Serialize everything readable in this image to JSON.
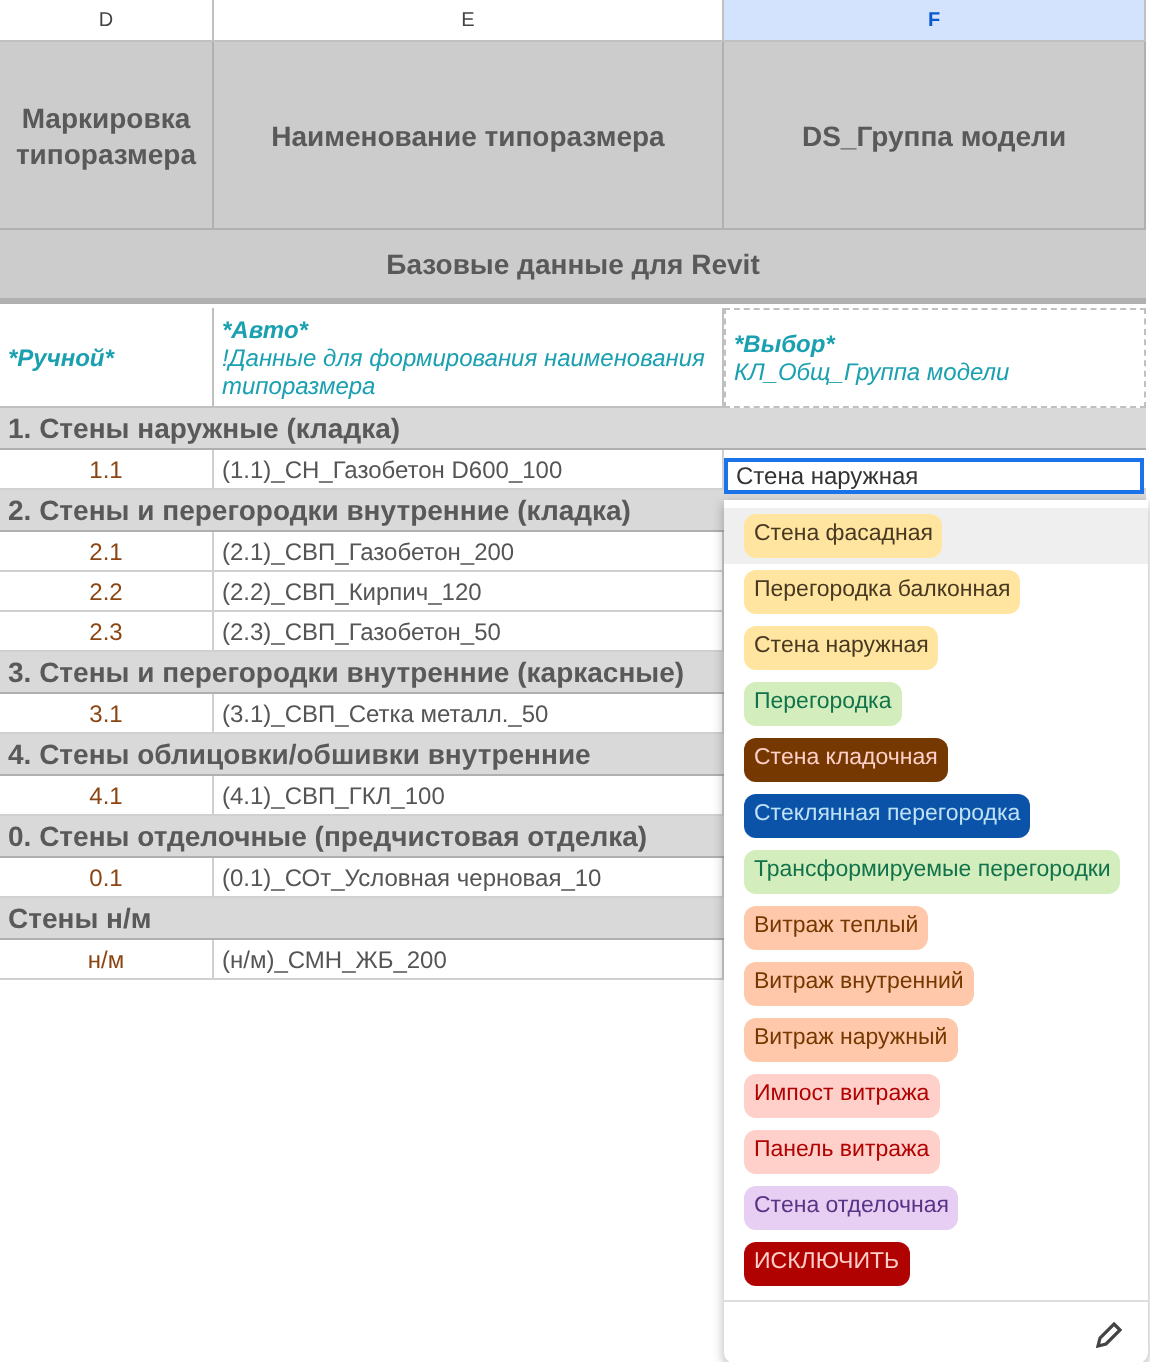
{
  "columns": [
    {
      "label": "D",
      "selected": false
    },
    {
      "label": "E",
      "selected": false
    },
    {
      "label": "F",
      "selected": true
    }
  ],
  "header": [
    "Маркировка типоразмера",
    "Наименование типоразмера",
    "DS_Группа модели"
  ],
  "subheader": "Базовые данные для Revit",
  "notes": [
    {
      "title": "*Ручной*"
    },
    {
      "title": "*Авто*",
      "text": "!Данные для формирования наименования типоразмера"
    },
    {
      "title": "*Выбор*",
      "text": "КЛ_Общ_Группа модели",
      "copy_marquee": true
    }
  ],
  "rows": [
    {
      "kind": "section",
      "label": "1. Стены наружные (кладка)"
    },
    {
      "kind": "item",
      "code": "1.1",
      "name": "(1.1)_СН_Газобетон D600_100"
    },
    {
      "kind": "section",
      "label": "2. Стены и перегородки внутренние (кладка)"
    },
    {
      "kind": "item",
      "code": "2.1",
      "name": "(2.1)_СВП_Газобетон_200"
    },
    {
      "kind": "item",
      "code": "2.2",
      "name": "(2.2)_СВП_Кирпич_120"
    },
    {
      "kind": "item",
      "code": "2.3",
      "name": "(2.3)_СВП_Газобетон_50"
    },
    {
      "kind": "section",
      "label": "3. Стены и перегородки внутренние (каркасные)"
    },
    {
      "kind": "item",
      "code": "3.1",
      "name": "(3.1)_СВП_Сетка металл._50"
    },
    {
      "kind": "section",
      "label": "4. Стены облицовки/обшивки внутренние"
    },
    {
      "kind": "item",
      "code": "4.1",
      "name": "(4.1)_СВП_ГКЛ_100"
    },
    {
      "kind": "section",
      "label": "0. Стены отделочные (предчистовая отделка)"
    },
    {
      "kind": "item",
      "code": "0.1",
      "name": "(0.1)_СОт_Условная черновая_10"
    },
    {
      "kind": "section",
      "label": "Стены н/м"
    },
    {
      "kind": "item",
      "code": "н/м",
      "name": "(н/м)_СМН_ЖБ_200"
    }
  ],
  "dropdown": {
    "value": "Стена наружная",
    "options": [
      {
        "label": "Стена фасадная",
        "color": "#ffe5a0",
        "highlighted": true
      },
      {
        "label": "Перегородка балконная",
        "color": "#ffe5a0",
        "highlighted": false
      },
      {
        "label": "Стена наружная",
        "color": "#ffe5a0",
        "highlighted": false
      },
      {
        "label": "Перегородка",
        "color": "#d4edbc",
        "highlighted": false
      },
      {
        "label": "Стена кладочная",
        "color": "#753800",
        "highlighted": false
      },
      {
        "label": "Стеклянная перегородка",
        "color": "#0a53a8",
        "highlighted": false
      },
      {
        "label": "Трансформируемые перегородки",
        "color": "#d4edbc",
        "highlighted": false
      },
      {
        "label": "Витраж теплый",
        "color": "#ffc8aa",
        "highlighted": false
      },
      {
        "label": "Витраж внутренний",
        "color": "#ffc8aa",
        "highlighted": false
      },
      {
        "label": "Витраж наружный",
        "color": "#ffc8aa",
        "highlighted": false
      },
      {
        "label": "Импост витража",
        "color": "#ffcfc9",
        "highlighted": false
      },
      {
        "label": "Панель витража",
        "color": "#ffcfc9",
        "highlighted": false
      },
      {
        "label": "Стена отделочная",
        "color": "#e6cff2",
        "highlighted": false
      },
      {
        "label": "ИСКЛЮЧИТЬ",
        "color": "#b10202",
        "highlighted": false
      }
    ]
  }
}
